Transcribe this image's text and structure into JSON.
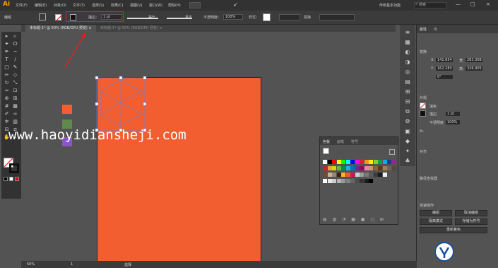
{
  "app": {
    "logo": "Ai"
  },
  "menu": [
    "文件(F)",
    "编辑(E)",
    "对象(O)",
    "文字(T)",
    "选择(S)",
    "效果(C)",
    "视图(V)",
    "窗口(W)",
    "帮助(H)"
  ],
  "workspace": "传统基本功能",
  "search_placeholder": "搜索",
  "window_controls": {
    "minimize": "—",
    "maximize": "□",
    "close": "×"
  },
  "control": {
    "selection_label": "编组",
    "stroke_label": "描边：",
    "stroke_value": "1 pt",
    "stroke_style": "等比",
    "brush_style": "基本",
    "opacity_label": "不透明度：",
    "opacity_value": "100%",
    "style_label": "样式：",
    "transform_label": "变换"
  },
  "tabs": [
    {
      "label": "未标题-1* @ 50% (RGB/GPU 预览)",
      "close": "×"
    },
    {
      "label": "未标题-1* @ 50% (RGB/GPU 预览)",
      "close": "×"
    }
  ],
  "tool_icons": [
    "selection-icon",
    "direct-selection-icon",
    "magic-wand-icon",
    "lasso-icon",
    "pen-icon",
    "curvature-icon",
    "type-icon",
    "line-icon",
    "rectangle-icon",
    "paintbrush-icon",
    "pencil-icon",
    "eraser-icon",
    "rotate-icon",
    "scale-icon",
    "width-icon",
    "free-transform-icon",
    "shape-builder-icon",
    "perspective-icon",
    "mesh-icon",
    "gradient-icon",
    "eyedropper-icon",
    "blend-icon",
    "symbol-sprayer-icon",
    "column-graph-icon",
    "artboard-icon",
    "slice-icon",
    "hand-icon",
    "zoom-icon"
  ],
  "tool_glyphs": [
    "▸",
    "▹",
    "✦",
    "ⵔ",
    "✒",
    "~",
    "T",
    "/",
    "□",
    "✎",
    "✏",
    "◇",
    "↻",
    "⤡",
    "≈",
    "⊡",
    "⊕",
    "⊞",
    "#",
    "▦",
    "✐",
    "∞",
    "✲",
    "▥",
    "⊟",
    "⧄",
    "✋",
    "⌕"
  ],
  "colors": {
    "artboard_fill": "#f35e30",
    "swatch_orange": "#f35e30",
    "swatch_green": "#5f8a4a",
    "swatch_purple": "#8a55c8",
    "selection": "#6a7fd4",
    "annotation_red": "#e02020"
  },
  "watermark": "www.haoyidiansheji.com",
  "swatches_panel": {
    "tabs": [
      "色板",
      "画笔",
      "符号"
    ],
    "rows": [
      [
        "#ffffff",
        "#000000",
        "#ff0000",
        "#ffff00",
        "#00ff00",
        "#00ffff",
        "#0000ff",
        "#ff00ff",
        "#ed1c24",
        "#f7941d",
        "#fff200",
        "#8dc63f",
        "#00a651",
        "#00aeef",
        "#2e3192",
        "#92278f"
      ],
      [
        "#c1272d",
        "#e8a33d",
        "#d6d600",
        "#6db33f",
        "#009245",
        "#29abe2",
        "#0071bc",
        "#662d91",
        "#9e005d",
        "#ff7bac",
        "#c69c6d",
        "#8c6239",
        "#603813",
        "#a67c52",
        "#736357",
        "#534741"
      ],
      [
        "#754c24",
        "#c7b299",
        "#998675",
        "#42210b",
        "#fbb03b",
        "#f15a24",
        "#d4145a",
        "#cfcfcf",
        "#9e9e9e",
        "#7a7a7a",
        "#5a5a5a",
        "#3a3a3a",
        "#1a1a1a",
        "#f0f0f0"
      ],
      [
        "#ffffff",
        "#e6e6e6",
        "#cccccc",
        "#b3b3b3",
        "#999999",
        "#808080",
        "#666666",
        "#4d4d4d",
        "#333333",
        "#1a1a1a",
        "#000000"
      ]
    ]
  },
  "right_panel": {
    "tabs": [
      "属性",
      "库"
    ],
    "section_transform": "变换",
    "x_label": "X:",
    "x_value": "141.654",
    "y_label": "Y:",
    "y_value": "162.283",
    "w_label": "宽:",
    "w_value": "283.308",
    "h_label": "高:",
    "h_value": "326.905",
    "angle_value": "0°",
    "section_appearance": "外观",
    "fill_label": "填色",
    "stroke_label": "描边",
    "stroke_value": "1 pt",
    "opacity_label": "不透明度",
    "opacity_value": "100%",
    "fx_label": "fx.",
    "section_align": "对齐",
    "section_pathfinder": "路径查找器",
    "section_quick": "快速操作",
    "btn_edit": "编组",
    "btn_ungroup": "取消编组",
    "btn_recolor": "隔离模式",
    "btn_arrange": "存储为符号",
    "btn_extra": "重新着色"
  },
  "status": {
    "zoom": "50%",
    "artboard_num": "1",
    "tool": "选择"
  }
}
